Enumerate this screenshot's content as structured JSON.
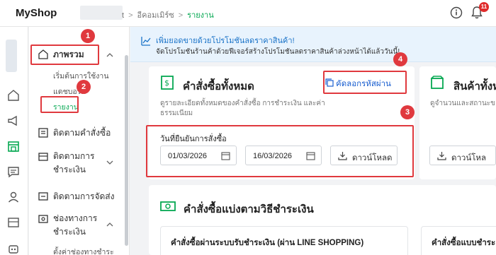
{
  "app": {
    "name": "MyShop"
  },
  "breadcrumb": {
    "items": [
      "t",
      "อีคอมเมิร์ซ",
      "รายงาน"
    ]
  },
  "header": {
    "notification_count": "11"
  },
  "sidebar": {
    "items": [
      {
        "label": "ภาพรวม",
        "icon": "home-icon"
      },
      {
        "label": "ติดตามคำสั่งซื้อ",
        "icon": "orders-icon"
      },
      {
        "label": "ติดตามการ\nชำระเงิน",
        "icon": "payment-icon"
      },
      {
        "label": "ติดตามการจัดส่ง",
        "icon": "shipping-icon"
      },
      {
        "label": "ช่องทางการ\nชำระเงิน",
        "icon": "channel-icon"
      }
    ],
    "sub_items": [
      "เริ่มต้นการใช้งาน",
      "แดชบอร์ด",
      "รายงาน"
    ],
    "truncated_bottom": "ตั้งค่าช่องทางชำระ"
  },
  "banner": {
    "title": "เพิ่มยอดขายด้วยโปรโมชันลดราคาสินค้า!",
    "subtitle": "จัดโปรโมชันร้านค้าด้วยฟีเจอร์สร้างโปรโมชันลดราคาสินค้าล่วงหน้าได้แล้ววันนี้!"
  },
  "orders_card": {
    "title": "คำสั่งซื้อทั้งหมด",
    "description": "ดูรายละเอียดทั้งหมดของคำสั่งซื้อ การชำระเงิน และค่าธรรมเนียม",
    "copy_link": "คัดลอกรหัสผ่าน",
    "date_label": "วันที่ยืนยันการสั่งซื้อ",
    "start_date": "01/03/2026",
    "end_date": "16/03/2026",
    "download": "ดาวน์โหลด"
  },
  "products_card": {
    "title": "สินค้าทั้งห",
    "description": "ดูจำนวนและสถานะของสิ",
    "download": "ดาวน์โหล"
  },
  "payment_section": {
    "title": "คำสั่งซื้อแบ่งตามวิธีชำระเงิน",
    "card1_title": "คำสั่งซื้อผ่านระบบรับชำระเงิน (ผ่าน LINE SHOPPING)",
    "card2_title": "คำสั่งซื้อแบบชำระ"
  },
  "annotations": [
    "1",
    "2",
    "3",
    "4"
  ],
  "colors": {
    "accent": "#06a852",
    "annotation": "#e0393e",
    "link": "#1a5fd0"
  }
}
